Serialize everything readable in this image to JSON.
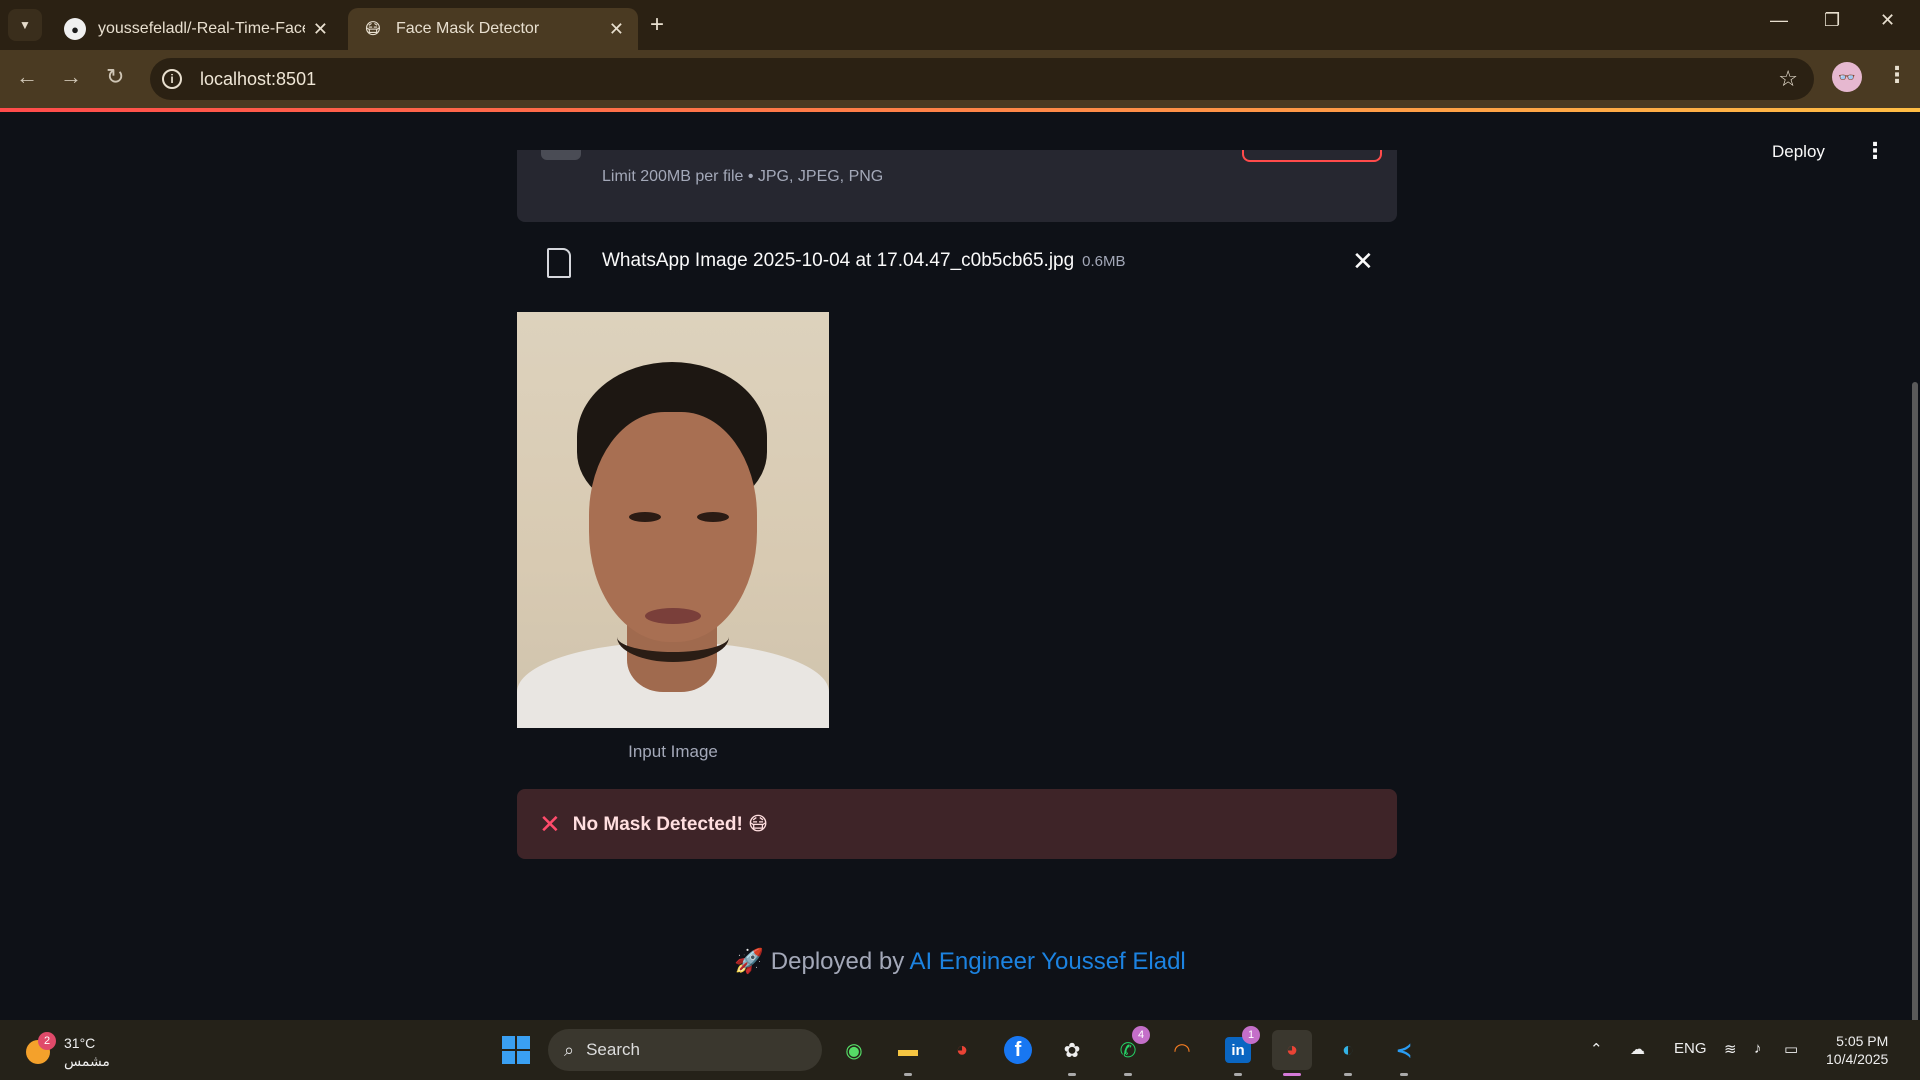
{
  "browser": {
    "tabs": [
      {
        "title": "youssefeladl/-Real-Time-Face-Mask-Detection",
        "icon": "github-icon",
        "active": false
      },
      {
        "title": "Face Mask Detector",
        "icon": "mask-emoji-icon",
        "active": true
      }
    ],
    "url": "localhost:8501"
  },
  "app": {
    "deploy_label": "Deploy",
    "uploader": {
      "limit_text": "Limit 200MB per file • JPG, JPEG, PNG"
    },
    "file": {
      "name": "WhatsApp Image 2025-10-04 at 17.04.47_c0b5cb65.jpg",
      "size": "0.6MB"
    },
    "image_caption": "Input Image",
    "alert": {
      "icon": "❌",
      "text": "No Mask Detected! 😷"
    },
    "footer": {
      "prefix": "🚀 Deployed by ",
      "link_text": "AI Engineer Youssef Eladl"
    }
  },
  "taskbar": {
    "weather": {
      "temp": "31°C",
      "condition": "مشمس",
      "badge": "2"
    },
    "search_placeholder": "Search",
    "badges": {
      "whatsapp": "4",
      "linkedin": "1"
    },
    "language": "ENG",
    "time": "5:05 PM",
    "date": "10/4/2025"
  }
}
